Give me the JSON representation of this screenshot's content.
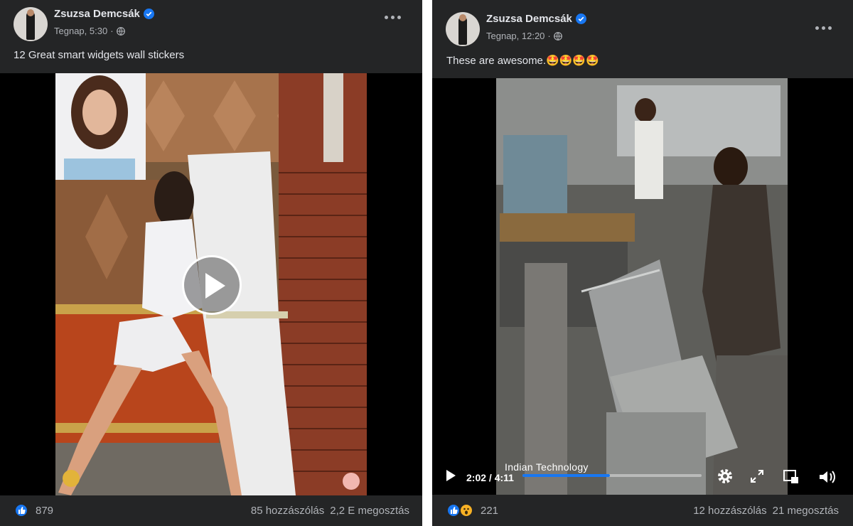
{
  "posts": [
    {
      "author": "Zsuzsa Demcsák",
      "time": "Tegnap, 5:30",
      "caption": "12 Great smart widgets wall stickers",
      "reactions_count": "879",
      "comments": "85 hozzászólás",
      "shares": "2,2 E megosztás"
    },
    {
      "author": "Zsuzsa Demcsák",
      "time": "Tegnap, 12:20",
      "caption": "These are awesome.🤩🤩🤩🤩",
      "reactions_count": "221",
      "comments": "12 hozzászólás",
      "shares": "21 megosztás",
      "video": {
        "time": "2:02 / 4:11",
        "title": "Indian Technology",
        "progress": 0.49
      }
    }
  ],
  "colors": {
    "card_bg": "#242526",
    "text_primary": "#e4e6eb",
    "text_secondary": "#b0b3b8",
    "accent": "#1877f2"
  }
}
